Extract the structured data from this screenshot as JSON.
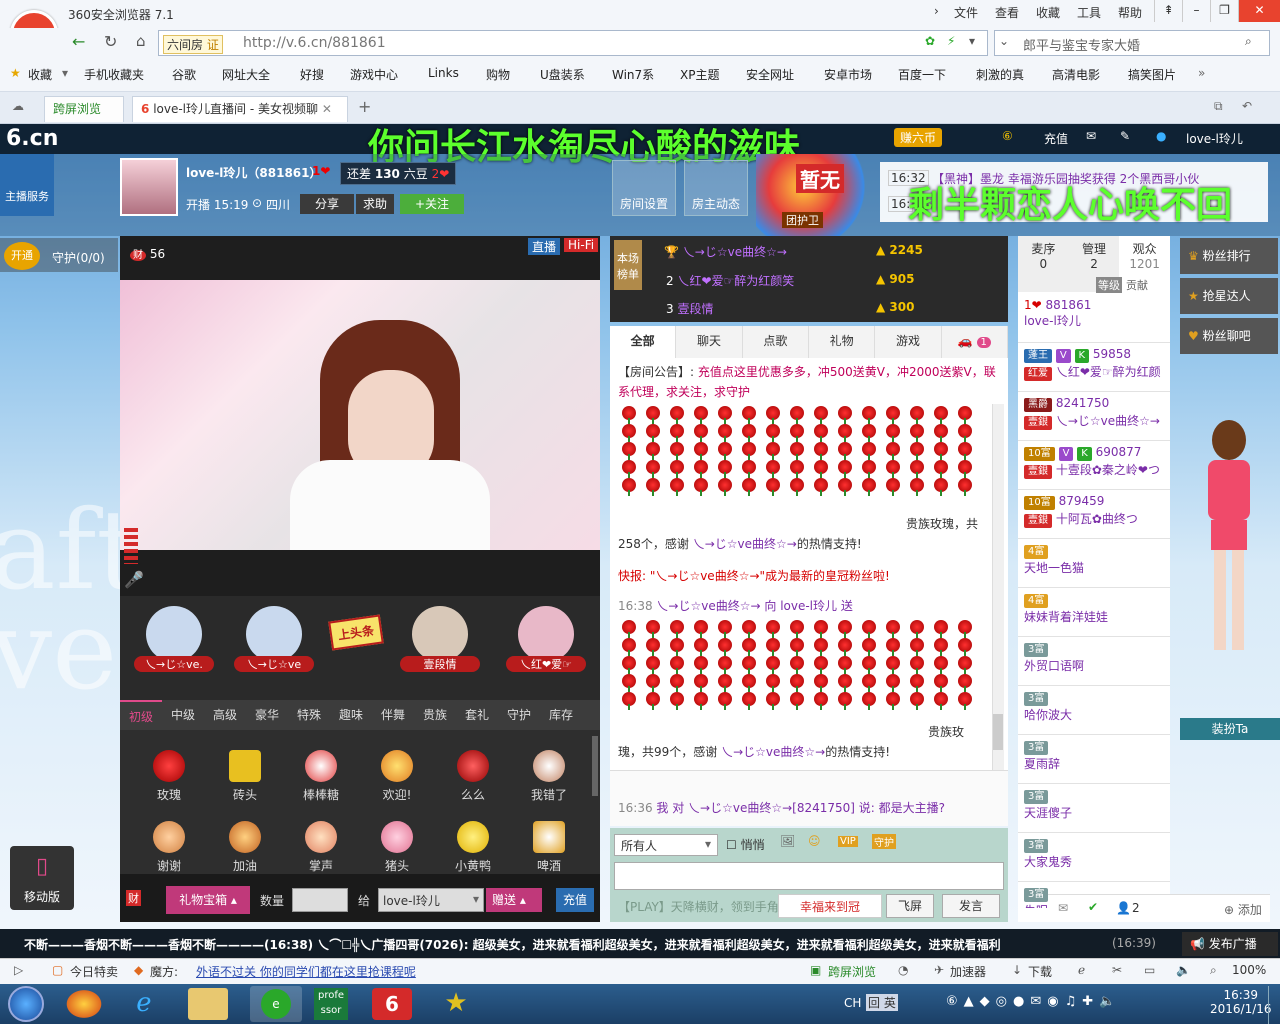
{
  "browser": {
    "title": "360安全浏览器 7.1",
    "menus": [
      "文件",
      "查看",
      "收藏",
      "工具",
      "帮助"
    ],
    "address_prefix": "六间房",
    "address_badge": "证",
    "url": "http://v.6.cn/881861",
    "search_text": "郎平与鉴宝专家大婚",
    "favorites_label": "收藏",
    "favorites": [
      "手机收藏夹",
      "谷歌",
      "网址大全",
      "好搜",
      "游戏中心",
      "Links",
      "购物",
      "U盘装系",
      "Win7系",
      "XP主题",
      "安全网址",
      "安卓市场",
      "百度一下",
      "刺激的真",
      "高清电影",
      "搞笑图片"
    ],
    "tabs": [
      "跨屏浏览",
      "love-l玲儿直播间 - 美女视频聊"
    ]
  },
  "site": {
    "logo": "6.cn",
    "banner_text": "你问长江水淘尽心酸的滋味",
    "banner_text2": "剩半颗恋人心唤不回",
    "top_right": [
      "赚六币",
      "充值",
      "love-l玲儿"
    ],
    "host_service": "主播服务",
    "host_name": "love-l玲儿（881861）",
    "host_level": "1",
    "gap_text": "还差",
    "gap_value": "130",
    "gap_unit": "六豆",
    "gap_level": "2",
    "live_time": "开播 15:19",
    "location": "四川",
    "share": "分享",
    "ask": "求助",
    "follow": "+关注",
    "room_settings": "房间设置",
    "host_feed": "房主动态",
    "no_guard": "暂无",
    "guard_team": "团护卫",
    "notice_time1": "16:32",
    "notice_time2": "16:",
    "notice_text": "【黑神】墨龙 幸福游乐园抽奖获得 2个黑西哥小伙",
    "open_guard": "开通",
    "guard_count": "守护(0/0)",
    "video_count": "56",
    "live_badge": "直播",
    "hifi_badge": "Hi-Fi",
    "headline_label": "上头条",
    "seat_names": [
      "乀→じ☆ve.",
      "乀→じ☆ve",
      "壹段情",
      "乀红❤爱☞"
    ],
    "gift_tabs": [
      "初级",
      "中级",
      "高级",
      "豪华",
      "特殊",
      "趣味",
      "伴舞",
      "贵族",
      "套礼",
      "守护",
      "库存"
    ],
    "gifts_row1": [
      "玫瑰",
      "砖头",
      "棒棒糖",
      "欢迎!",
      "么么",
      "我错了"
    ],
    "gifts_row2": [
      "谢谢",
      "加油",
      "掌声",
      "猪头",
      "小黄鸭",
      "啤酒"
    ],
    "gift_box": "礼物宝箱",
    "qty_label": "数量",
    "to_label": "给",
    "to_name": "love-l玲儿",
    "give": "赠送",
    "recharge": "充值",
    "mobile": "移动版",
    "rank_label": "本场榜单",
    "rank": [
      {
        "n": "1",
        "name": "乀→じ☆ve曲终☆→",
        "score": "2245"
      },
      {
        "n": "2",
        "name": "乀红❤爱☞醉为红颜笑",
        "score": "905"
      },
      {
        "n": "3",
        "name": "壹段情",
        "score": "300"
      }
    ],
    "chat_tabs": [
      "全部",
      "聊天",
      "点歌",
      "礼物",
      "游戏"
    ],
    "car_count": "1",
    "announce_head": "【房间公告】:",
    "announce": "充值点这里优惠多多，冲500送黄V，冲2000送紫V，联系代理，求关注，求守护",
    "gift_msg1_tail": "贵族玫瑰，共",
    "gift_msg1_end": "258个，感谢",
    "gift_msg1_nick": "乀→じ☆ve曲终☆→",
    "thanks": "的热情支持!",
    "flash_label": "快报:",
    "flash": "\"乀→じ☆ve曲终☆→\"成为最新的皇冠粉丝啦!",
    "msg2_time": "16:38",
    "msg2_from": "乀→じ☆ve曲终☆→",
    "msg2_to": "向 love-l玲儿 送",
    "gift_msg2_tail": "贵族玫",
    "gift_msg2_end": "瑰，共99个，感谢",
    "msg3_time": "16:36",
    "msg3": "我 对 乀→じ☆ve曲终☆→[8241750] 说: 都是大主播?",
    "to_all": "所有人",
    "whisper": "悄悄",
    "play_text": "【PLAY】天降横财，领到手角",
    "lucky": "幸福来到冠",
    "fly": "飞屏",
    "send": "发言",
    "list_tabs": [
      {
        "label": "麦序",
        "n": "0"
      },
      {
        "label": "管理",
        "n": "2"
      },
      {
        "label": "观众",
        "n": "1201"
      }
    ],
    "list_sub": [
      "等级",
      "贡献"
    ],
    "viewers": [
      {
        "id": "881861",
        "name": "love-l玲儿",
        "badge": "1"
      },
      {
        "id": "59858",
        "name": "乀红❤爱☞醉为红颜",
        "badge": "红爱"
      },
      {
        "id": "8241750",
        "name": "乀→じ☆ve曲终☆→",
        "badge": "壹銀"
      },
      {
        "id": "690877",
        "name": "十壹段✿秦之岭❤つ",
        "badge": "壹銀"
      },
      {
        "id": "879459",
        "name": "十阿瓦✿曲终つ",
        "badge": "壹銀"
      },
      {
        "id": "",
        "name": "天地一色猫",
        "badge": "4富"
      },
      {
        "id": "",
        "name": "妹妹背着洋娃娃",
        "badge": "4富"
      },
      {
        "id": "",
        "name": "外贸口语啊",
        "badge": "3富"
      },
      {
        "id": "",
        "name": "哈你波大",
        "badge": "3富"
      },
      {
        "id": "",
        "name": "夏雨辞",
        "badge": "3富"
      },
      {
        "id": "",
        "name": "天涯傻子",
        "badge": "3富"
      },
      {
        "id": "",
        "name": "大家鬼秀",
        "badge": "3富"
      },
      {
        "id": "",
        "name": "失眠",
        "badge": "3富"
      }
    ],
    "side_buttons": [
      "粉丝排行",
      "抢星达人",
      "粉丝聊吧"
    ],
    "dress_up": "装扮Ta",
    "foot_count": "2",
    "foot_add": "添加",
    "broadcast": "不断———香烟不断———香烟不断————(16:38)  乀⌒☐╬乀广播四哥(7026): 超级美女，进来就看福利超级美女，进来就看福利超级美女，进来就看福利超级美女，进来就看福利",
    "broadcast_time": "(16:39)",
    "publish": "发布广播"
  },
  "status": {
    "today": "今日特卖",
    "magic": "魔方:",
    "promo": "外语不过关 你的同学们都在这里抢课程呢",
    "cross": "跨屏浏览",
    "accel": "加速器",
    "download": "下载",
    "zoom": "100%"
  },
  "taskbar": {
    "time": "16:39",
    "date": "2016/1/16",
    "lang": "CH",
    "apps": [
      "profe ssor"
    ]
  }
}
